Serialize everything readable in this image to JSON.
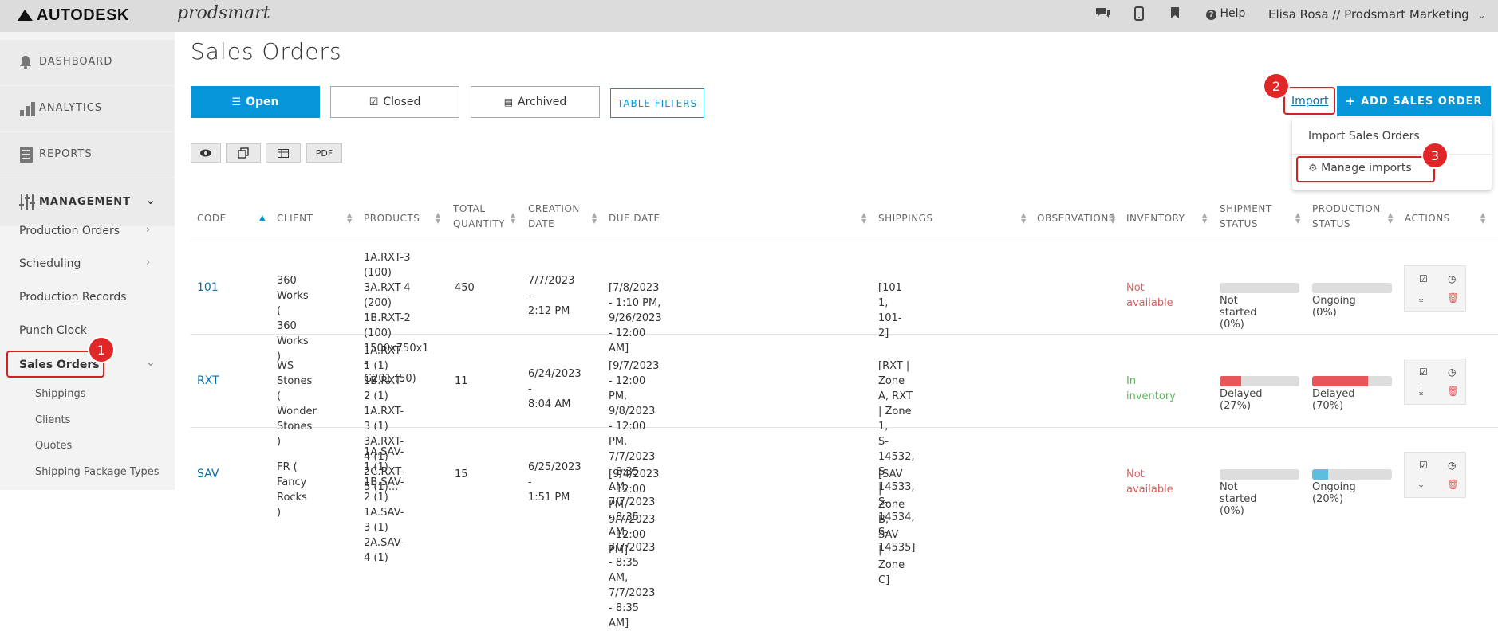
{
  "header": {
    "brand": "AUTODESK",
    "product": "prodsmart",
    "help_label": "Help",
    "user": "Elisa Rosa // Prodsmart Marketing",
    "icons": [
      "chat-icon",
      "mobile-icon",
      "bookmark-icon",
      "question-icon"
    ]
  },
  "sidebar": {
    "modules": [
      {
        "label": "DASHBOARD",
        "icon": "bell-icon"
      },
      {
        "label": "ANALYTICS",
        "icon": "bar-chart-icon"
      },
      {
        "label": "REPORTS",
        "icon": "document-icon"
      },
      {
        "label": "MANAGEMENT",
        "icon": "sliders-icon"
      }
    ],
    "items": [
      {
        "label": "Production Orders"
      },
      {
        "label": "Scheduling"
      },
      {
        "label": "Production Records"
      },
      {
        "label": "Punch Clock"
      },
      {
        "label": "Sales Orders"
      }
    ],
    "subitems": [
      {
        "label": "Shippings"
      },
      {
        "label": "Clients"
      },
      {
        "label": "Quotes"
      },
      {
        "label": "Shipping Package Types"
      }
    ]
  },
  "page": {
    "title": "Sales Orders",
    "tabs": [
      {
        "label": "Open"
      },
      {
        "label": "Closed"
      },
      {
        "label": "Archived"
      }
    ],
    "filters_label": "TABLE FILTERS",
    "pdf_label": "PDF",
    "import_label": "Import",
    "add_label": "ADD SALES ORDER",
    "dropdown": {
      "import_sales_orders": "Import Sales Orders",
      "manage_imports": "Manage imports"
    }
  },
  "markers": [
    "1",
    "2",
    "3"
  ],
  "colors": {
    "accent": "#0696d7",
    "marker": "#e02626",
    "not_available": "#e05c5c",
    "in_inventory": "#5cb85c",
    "delayed": "#e8565a",
    "ongoing": "#5bc0de"
  },
  "table": {
    "columns": [
      {
        "label": "CODE"
      },
      {
        "label": "CLIENT"
      },
      {
        "label": "PRODUCTS"
      },
      {
        "label": "TOTAL\nQUANTITY"
      },
      {
        "label": "CREATION\nDATE"
      },
      {
        "label": "DUE DATE"
      },
      {
        "label": "SHIPPINGS"
      },
      {
        "label": "OBSERVATIONS"
      },
      {
        "label": "INVENTORY"
      },
      {
        "label": "SHIPMENT\nSTATUS"
      },
      {
        "label": "PRODUCTION\nSTATUS"
      },
      {
        "label": "ACTIONS"
      }
    ],
    "rows": [
      {
        "code": "101",
        "client": "360 Works (\n360 Works )",
        "products": "1A.RXT-3 (100)\n3A.RXT-4 (200)\n1B.RXT-2 (100)\n1500x750x1 -\nG201 (50)",
        "quantity": "450",
        "created": "7/7/2023 -\n2:12 PM",
        "due": "[7/8/2023 - 1:10 PM, 9/26/2023 - 12:00 AM]",
        "shippings": "[101-1, 101-2]",
        "inventory": "Not available",
        "shipment": {
          "label": "Not started (0%)",
          "progress": 0,
          "color": "#e8565a"
        },
        "production": {
          "label": "Ongoing (0%)",
          "progress": 0,
          "color": "#5bc0de"
        }
      },
      {
        "code": "RXT",
        "client": "WS Stones (\nWonder Stones\n)",
        "products": "1A.RXT-1 (1)\n1B.RXT-2 (1)\n1A.RXT-3 (1)\n3A.RXT-4 (1)\n2C.RXT-5 (1)...",
        "quantity": "11",
        "created": "6/24/2023 -\n8:04 AM",
        "due": "[9/7/2023 - 12:00 PM, 9/8/2023 - 12:00 PM, 7/7/2023\n- 8:35 AM, 7/7/2023 - 8:35 AM, 7/7/2023 - 8:35 AM,\n7/7/2023 - 8:35 AM]",
        "shippings": "[RXT | Zone A, RXT | Zone 1,\nS-14532, S-14533, S-14534, S-\n14535]",
        "inventory": "In inventory",
        "shipment": {
          "label": "Delayed (27%)",
          "progress": 0.27,
          "color": "#e8565a"
        },
        "production": {
          "label": "Delayed (70%)",
          "progress": 0.7,
          "color": "#e8565a"
        }
      },
      {
        "code": "SAV",
        "client": "FR ( Fancy\nRocks )",
        "products": "1A.SAV-1 (1)\n1B.SAV-2 (1)\n1A.SAV-3 (1)\n2A.SAV-4 (1)",
        "quantity": "15",
        "created": "6/25/2023 -\n1:51 PM",
        "due": "[9/4/2023 - 12:00 PM, 9/7/2023 - 12:00 PM]",
        "shippings": "[SAV | Zone B, SAV | Zone C]",
        "inventory": "Not available",
        "shipment": {
          "label": "Not started (0%)",
          "progress": 0,
          "color": "#e8565a"
        },
        "production": {
          "label": "Ongoing (20%)",
          "progress": 0.2,
          "color": "#5bc0de"
        }
      }
    ]
  }
}
